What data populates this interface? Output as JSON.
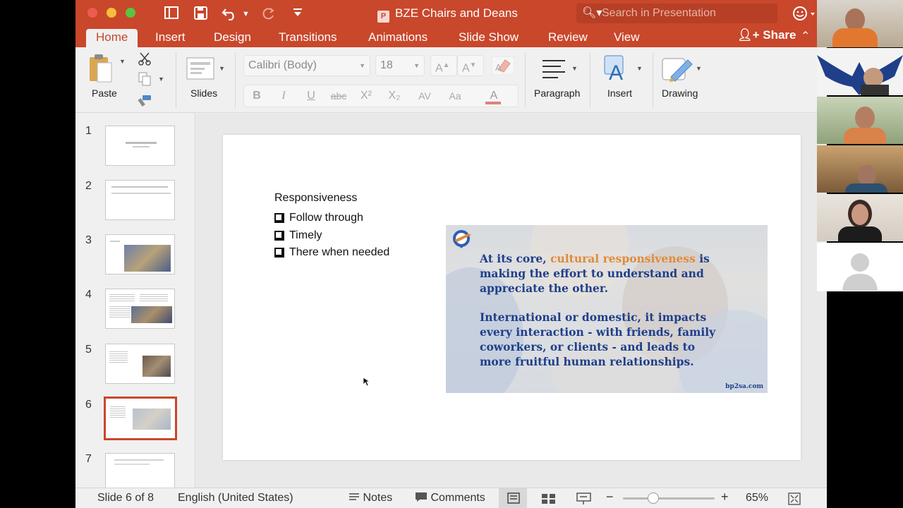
{
  "window": {
    "title": "BZE Chairs and Deans",
    "search_placeholder": "Search in Presentation"
  },
  "tabs": [
    "Home",
    "Insert",
    "Design",
    "Transitions",
    "Animations",
    "Slide Show",
    "Review",
    "View"
  ],
  "share_label": "Share",
  "ribbon": {
    "paste": "Paste",
    "slides": "Slides",
    "font_name": "Calibri (Body)",
    "font_size": "18",
    "paragraph": "Paragraph",
    "insert": "Insert",
    "drawing": "Drawing",
    "format_buttons": {
      "bold": "B",
      "italic": "I",
      "underline": "U",
      "strike": "abc",
      "superscript": "X²",
      "subscript": "X₂",
      "spacing": "AV",
      "case": "Aa",
      "font_color": "A"
    },
    "grow": "A",
    "shrink": "A"
  },
  "thumbnails": [
    "1",
    "2",
    "3",
    "4",
    "5",
    "6",
    "7"
  ],
  "selected_slide": "6",
  "slide": {
    "title": "Responsiveness",
    "bullets": [
      "Follow through",
      "Timely",
      "There when needed"
    ],
    "image_text": {
      "line1_pre": "At its core, ",
      "line1_highlight": "cultural responsiveness",
      "line1_post": " is",
      "line2": "making the effort to understand and",
      "line3": "appreciate the other.",
      "line4": "International or domestic, it impacts",
      "line5": "every interaction - with friends, family",
      "line6": "coworkers, or clients - and leads to",
      "line7": "more fruitful human relationships.",
      "credit": "bp2sa.com"
    }
  },
  "status": {
    "slide_counter": "Slide 6 of 8",
    "language": "English (United States)",
    "notes": "Notes",
    "comments": "Comments",
    "zoom": "65%",
    "zoom_minus": "−",
    "zoom_plus": "+"
  },
  "colors": {
    "accent": "#c9472b",
    "image_text": "#1f3f8a",
    "highlight": "#e08a3a"
  }
}
